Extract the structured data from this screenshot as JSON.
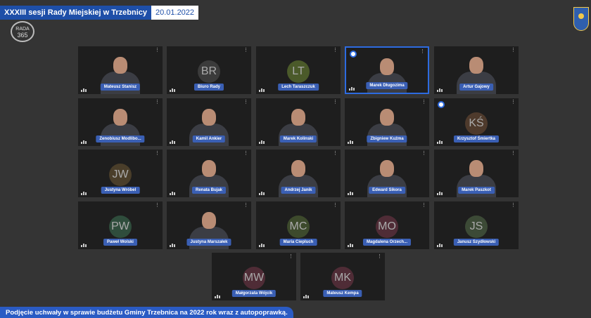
{
  "header": {
    "session_title": "XXXIII sesji Rady Miejskiej w Trzebnicy",
    "date": "20.01.2022"
  },
  "logo": {
    "line1": "RADA",
    "line2": "365"
  },
  "participants": [
    {
      "name": "Mateusz Stanisz",
      "initials": "",
      "initials_color": "",
      "video": true
    },
    {
      "name": "Biuro Rady",
      "initials": "BR",
      "initials_color": "#3b3b3b",
      "video": false
    },
    {
      "name": "Lech Taraszczuk",
      "initials": "LT",
      "initials_color": "#4b5a2a",
      "video": false
    },
    {
      "name": "Marek Długozima",
      "initials": "",
      "initials_color": "",
      "video": true,
      "active": true
    },
    {
      "name": "Artur Gajowy",
      "initials": "",
      "initials_color": "",
      "video": true
    },
    {
      "name": "Zenobiusz Modlibo...",
      "initials": "",
      "initials_color": "",
      "video": true
    },
    {
      "name": "Kamil Ankier",
      "initials": "",
      "initials_color": "",
      "video": true
    },
    {
      "name": "Marek Kolinski",
      "initials": "",
      "initials_color": "",
      "video": true
    },
    {
      "name": "Zbigniew Kuźma",
      "initials": "",
      "initials_color": "",
      "video": true
    },
    {
      "name": "Krzysztof Śmiertka",
      "initials": "KŚ",
      "initials_color": "#4e3a2c",
      "video": false,
      "pinned": true
    },
    {
      "name": "Justyna Wróbel",
      "initials": "JW",
      "initials_color": "#4a3e2a",
      "video": false
    },
    {
      "name": "Renata Bujak",
      "initials": "",
      "initials_color": "",
      "video": true
    },
    {
      "name": "Andrzej Janik",
      "initials": "",
      "initials_color": "",
      "video": true
    },
    {
      "name": "Edward Sikora",
      "initials": "",
      "initials_color": "",
      "video": true
    },
    {
      "name": "Marek Paszkot",
      "initials": "",
      "initials_color": "",
      "video": true
    },
    {
      "name": "Paweł Wolski",
      "initials": "PW",
      "initials_color": "#2f4d3c",
      "video": false
    },
    {
      "name": "Justyna Marszałek",
      "initials": "",
      "initials_color": "",
      "video": true
    },
    {
      "name": "Maria Ciepluch",
      "initials": "MC",
      "initials_color": "#3d4a2c",
      "video": false
    },
    {
      "name": "Magdalena Orzech...",
      "initials": "MO",
      "initials_color": "#4f2c36",
      "video": false
    },
    {
      "name": "Janusz Szydłowski",
      "initials": "JS",
      "initials_color": "#3c4a36",
      "video": false
    },
    {
      "name": "Małgorzata Wójcik",
      "initials": "MW",
      "initials_color": "#4f2c36",
      "video": false
    },
    {
      "name": "Mateusz Kempa",
      "initials": "MK",
      "initials_color": "#4f2c36",
      "video": false
    }
  ],
  "bottom_banner": "Podjęcie uchwały w sprawie budżetu Gminy Trzebnica na 2022 rok wraz z autopoprawką."
}
